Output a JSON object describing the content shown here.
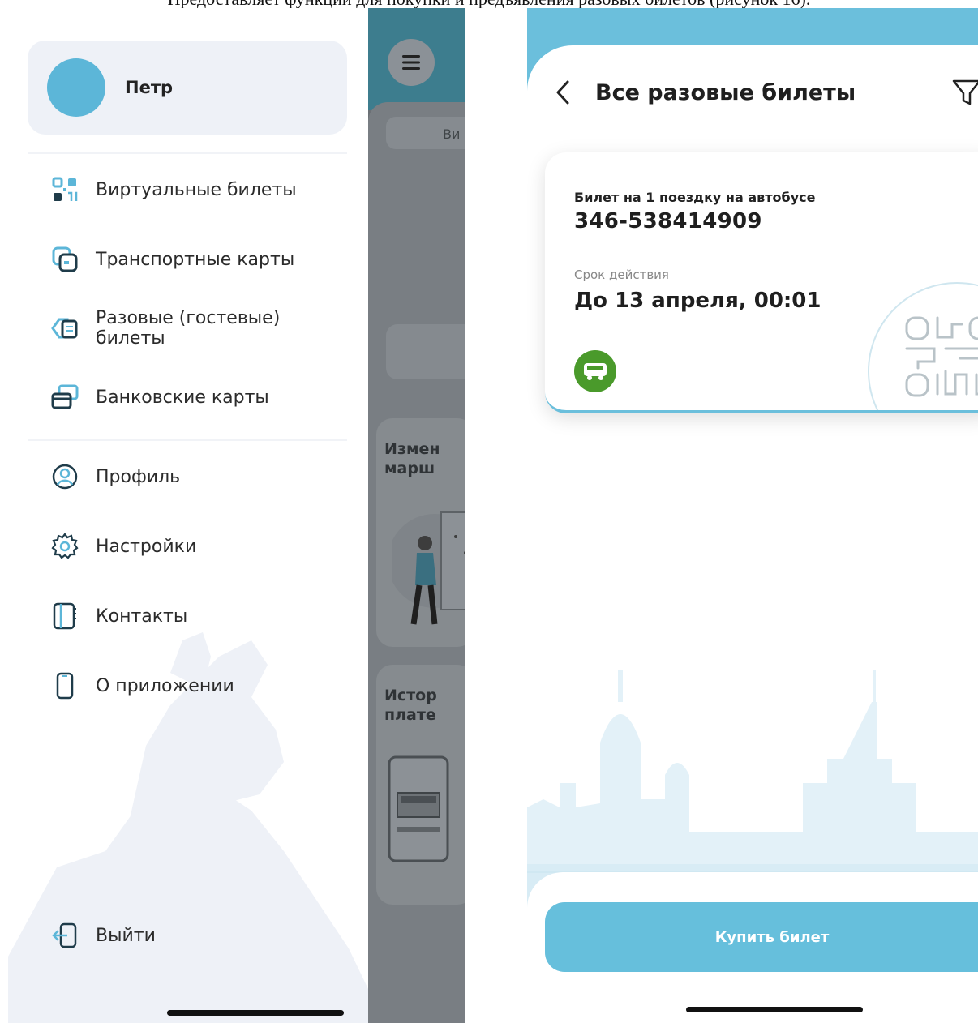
{
  "caption": "Предоставляет функции для покупки и предъявления разовых билетов (рисунок 16).",
  "drawer": {
    "profile_name": "Петр",
    "menu_primary": [
      {
        "label": "Виртуальные билеты",
        "icon": "qr-code-icon"
      },
      {
        "label": "Транспортные карты",
        "icon": "transport-card-icon"
      },
      {
        "label": "Разовые (гостевые) билеты",
        "icon": "ticket-icon"
      },
      {
        "label": "Банковские карты",
        "icon": "bank-card-icon"
      }
    ],
    "menu_secondary": [
      {
        "label": "Профиль",
        "icon": "profile-icon"
      },
      {
        "label": "Настройки",
        "icon": "settings-icon"
      },
      {
        "label": "Контакты",
        "icon": "contacts-icon"
      },
      {
        "label": "О приложении",
        "icon": "phone-icon"
      }
    ],
    "logout_label": "Выйти"
  },
  "background_screen": {
    "tab_partial": "Ви",
    "card1_title": "Измен\nмарш",
    "card2_title": "Истор\nплате"
  },
  "tickets_screen": {
    "title": "Все разовые билеты",
    "ticket": {
      "type": "Билет на 1 поездку на автобусе",
      "number": "346-538414909",
      "validity_label": "Срок действия",
      "validity_value": "До 13 апреля, 00:01"
    },
    "buy_button": "Купить билет"
  },
  "colors": {
    "accent": "#66bfdc",
    "bus_badge": "#4a9a2b",
    "drawer_card": "#eef1f7"
  }
}
